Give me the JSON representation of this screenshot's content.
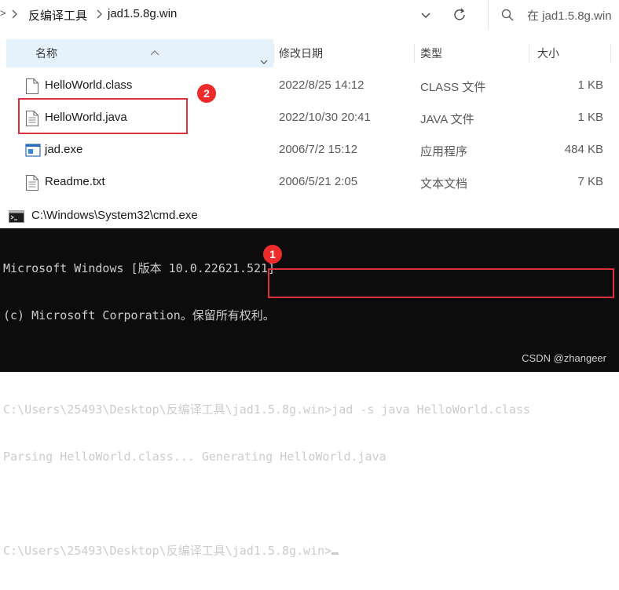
{
  "explorer": {
    "breadcrumb": [
      "反编译工具",
      "jad1.5.8g.win"
    ],
    "search_placeholder": "在 jad1.5.8g.win",
    "columns": {
      "name": "名称",
      "modified": "修改日期",
      "type": "类型",
      "size": "大小"
    },
    "files": [
      {
        "name": "HelloWorld.class",
        "modified": "2022/8/25 14:12",
        "type": "CLASS 文件",
        "size": "1 KB",
        "icon": "file-icon"
      },
      {
        "name": "HelloWorld.java",
        "modified": "2022/10/30 20:41",
        "type": "JAVA 文件",
        "size": "1 KB",
        "icon": "text-file-icon"
      },
      {
        "name": "jad.exe",
        "modified": "2006/7/2 15:12",
        "type": "应用程序",
        "size": "484 KB",
        "icon": "exe-icon"
      },
      {
        "name": "Readme.txt",
        "modified": "2006/5/21 2:05",
        "type": "文本文档",
        "size": "7 KB",
        "icon": "text-file-icon"
      }
    ],
    "annotation_badge": "2"
  },
  "cmd": {
    "title": "C:\\Windows\\System32\\cmd.exe",
    "lines": [
      "Microsoft Windows [版本 10.0.22621.521]",
      "(c) Microsoft Corporation。保留所有权利。",
      "",
      "C:\\Users\\25493\\Desktop\\反编译工具\\jad1.5.8g.win>jad -s java HelloWorld.class",
      "Parsing HelloWorld.class... Generating HelloWorld.java",
      "",
      "C:\\Users\\25493\\Desktop\\反编译工具\\jad1.5.8g.win>"
    ],
    "annotation_badge": "1",
    "watermark": "CSDN @zhangeer"
  },
  "colors": {
    "annotation_red": "#e0303b",
    "header_highlight": "#e5f1fb",
    "console_bg": "#0c0c0c",
    "console_text": "#cccccc"
  }
}
